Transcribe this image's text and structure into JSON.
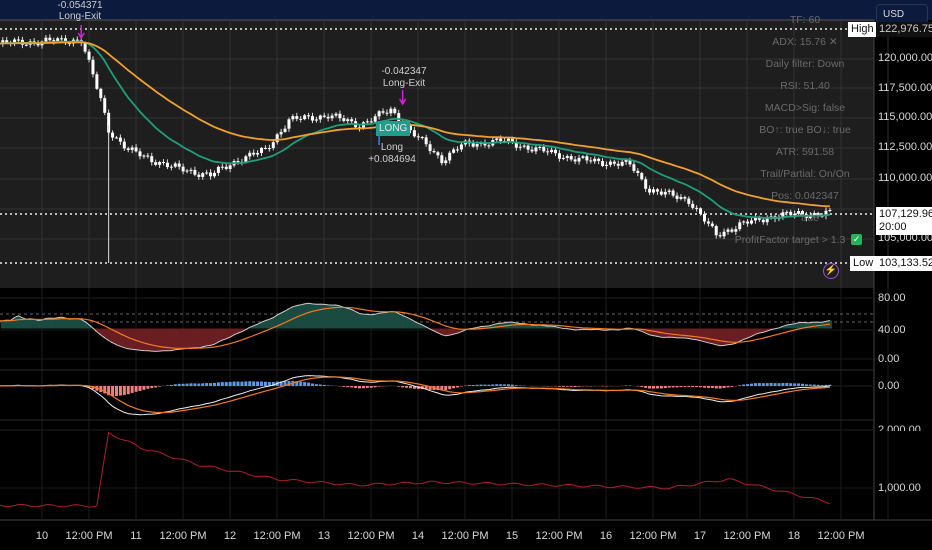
{
  "header": {
    "currency_button": "USD"
  },
  "price_axis": {
    "ticks": [
      "120,000.00",
      "117,500.00",
      "115,000.00",
      "112,500.00",
      "110,000.00",
      "105,000.00"
    ],
    "high_label": "High",
    "high_value": "122,976.75",
    "low_label": "Low",
    "low_value": "103,133.52",
    "last_price": "107,129.96",
    "countdown": "20:00"
  },
  "rsi_axis": [
    "80.00",
    "40.00",
    "0.00"
  ],
  "macd_axis": [
    "0.00"
  ],
  "atr_axis": [
    "2,000.00",
    "1,000.00"
  ],
  "time_axis": [
    "10",
    "12:00 PM",
    "11",
    "12:00 PM",
    "12",
    "12:00 PM",
    "13",
    "12:00 PM",
    "14",
    "12:00 PM",
    "15",
    "12:00 PM",
    "16",
    "12:00 PM",
    "17",
    "12:00 PM",
    "18",
    "12:00 PM"
  ],
  "info_panel": [
    "TF: 60",
    "ADX: 15.76 ✕",
    "Daily filter: Down",
    "RSI: 51.40",
    "MACD>Sig: false",
    "BO↑: true  BO↓: true",
    "ATR: 591.58",
    "Trail/Partial: On/On",
    "Pos: 0.042347",
    "true",
    "ProfitFactor target > 1.3"
  ],
  "annotations": {
    "exit1_value": "-0.054371",
    "exit1_label": "Long-Exit",
    "exit2_value": "-0.042347",
    "exit2_label": "Long-Exit",
    "entry_box": "LONG",
    "entry_label": "Long",
    "entry_value": "+0.084694"
  },
  "colors": {
    "ema_fast": "#1f9e7a",
    "ema_slow": "#f0a030",
    "candle": "#ffffff",
    "marker": "#d020e0"
  },
  "chart_data": {
    "type": "candlestick",
    "price_path": [
      [
        -11,
        121300
      ],
      [
        10,
        121600
      ],
      [
        15,
        116600
      ],
      [
        17,
        114100
      ],
      [
        22,
        112400
      ],
      [
        33,
        111000
      ],
      [
        43,
        110300
      ],
      [
        50,
        111600
      ],
      [
        57,
        112400
      ],
      [
        63,
        114900
      ],
      [
        73,
        115300
      ],
      [
        81,
        114500
      ],
      [
        89,
        115750
      ],
      [
        94,
        114000
      ],
      [
        102,
        111600
      ],
      [
        107,
        112800
      ],
      [
        117,
        113200
      ],
      [
        127,
        112400
      ],
      [
        137,
        111600
      ],
      [
        150,
        111200
      ],
      [
        155,
        109100
      ],
      [
        165,
        108250
      ],
      [
        172,
        105300
      ],
      [
        178,
        106200
      ],
      [
        188,
        107000
      ],
      [
        201,
        107130
      ]
    ],
    "atr_path": [
      [
        -11,
        700
      ],
      [
        14,
        690
      ],
      [
        17,
        1950
      ],
      [
        25,
        1700
      ],
      [
        40,
        1400
      ],
      [
        60,
        1150
      ],
      [
        80,
        1050
      ],
      [
        100,
        1100
      ],
      [
        130,
        1050
      ],
      [
        160,
        1000
      ],
      [
        175,
        1150
      ],
      [
        185,
        1000
      ],
      [
        201,
        750
      ]
    ],
    "ylim": [
      102500,
      123000
    ]
  }
}
